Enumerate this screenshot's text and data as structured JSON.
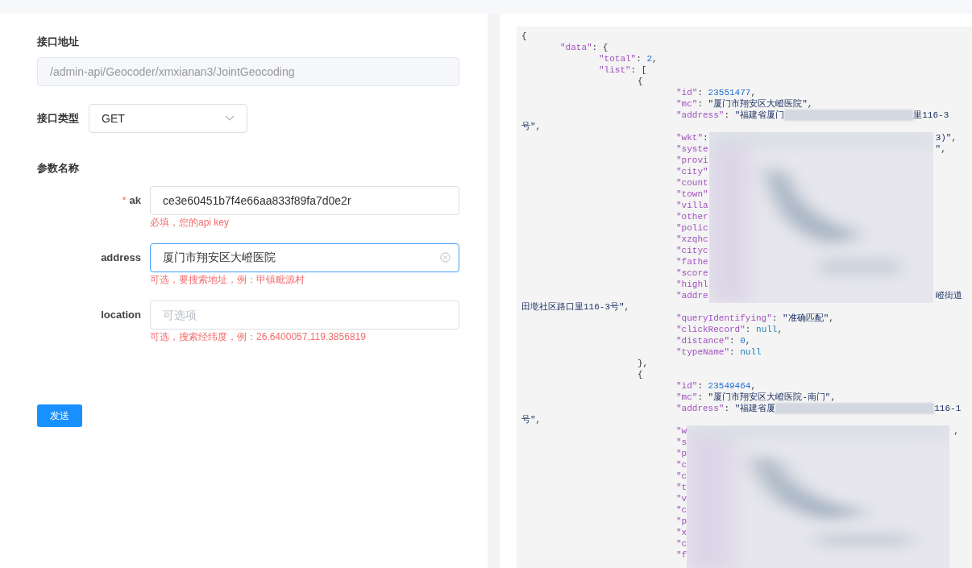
{
  "form": {
    "url": {
      "label": "接口地址",
      "value": "/admin-api/Geocoder/xmxianan3/JointGeocoding",
      "disabled": true
    },
    "method": {
      "label": "接口类型",
      "value": "GET"
    },
    "params_label": "参数名称",
    "required_mark": "*",
    "params": [
      {
        "label": "ak",
        "required": true,
        "value": "ce3e60451b7f4e66aa833f89fa7d0e2r",
        "focused": false,
        "hint": "必填，您的api key"
      },
      {
        "label": "address",
        "required": false,
        "value": "厦门市翔安区大嶝医院",
        "focused": true,
        "hint": "可选，要搜索地址，例：甲镇毗源村"
      },
      {
        "label": "location",
        "required": false,
        "placeholder": "可选项",
        "focused": false,
        "hint": "可选，搜索经纬度，例：26.6400057,119.3856819"
      }
    ],
    "submit": "发送"
  },
  "response": {
    "lines": [
      {
        "parts": [
          {
            "kind": "punct",
            "text": "{"
          }
        ],
        "children": [
          {
            "parts": [
              {
                "kind": "key",
                "text": "\"data\""
              },
              {
                "kind": "punct",
                "text": ": {"
              }
            ],
            "children": [
              {
                "parts": [
                  {
                    "kind": "key",
                    "text": "\"total\""
                  },
                  {
                    "kind": "punct",
                    "text": ": "
                  },
                  {
                    "kind": "num",
                    "text": "2"
                  },
                  {
                    "kind": "punct",
                    "text": ","
                  }
                ]
              },
              {
                "parts": [
                  {
                    "kind": "key",
                    "text": "\"list\""
                  },
                  {
                    "kind": "punct",
                    "text": ": ["
                  }
                ],
                "children": [
                  {
                    "parts": [
                      {
                        "kind": "punct",
                        "text": "{"
                      }
                    ],
                    "children": [
                      {
                        "parts": [
                          {
                            "kind": "key",
                            "text": "\"id\""
                          },
                          {
                            "kind": "punct",
                            "text": ": "
                          },
                          {
                            "kind": "num",
                            "text": "23551477"
                          },
                          {
                            "kind": "punct",
                            "text": ","
                          }
                        ]
                      },
                      {
                        "parts": [
                          {
                            "kind": "key",
                            "text": "\"mc\""
                          },
                          {
                            "kind": "punct",
                            "text": ": "
                          },
                          {
                            "kind": "str",
                            "text": "\"厦门市翔安区大嶝医院\""
                          },
                          {
                            "kind": "punct",
                            "text": ","
                          }
                        ]
                      },
                      {
                        "parts": [
                          {
                            "kind": "key",
                            "text": "\"address\""
                          },
                          {
                            "kind": "punct",
                            "text": ": "
                          },
                          {
                            "kind": "str",
                            "text": "\"福建省厦门"
                          },
                          {
                            "kind": "redacted"
                          },
                          {
                            "kind": "str",
                            "text": "里116-3"
                          }
                        ],
                        "wrap": [
                          {
                            "kind": "str",
                            "text": "号\""
                          },
                          {
                            "kind": "punct",
                            "text": ","
                          }
                        ]
                      },
                      {
                        "parts": [
                          {
                            "kind": "key",
                            "text": "\"wkt\""
                          },
                          {
                            "kind": "punct",
                            "text": ":"
                          },
                          {
                            "kind": "redacted"
                          },
                          {
                            "kind": "str",
                            "text": "3)\""
                          },
                          {
                            "kind": "punct",
                            "text": ","
                          }
                        ]
                      },
                      {
                        "parts": [
                          {
                            "kind": "key",
                            "text": "\"syste"
                          },
                          {
                            "kind": "redacted"
                          },
                          {
                            "kind": "str",
                            "text": "\""
                          },
                          {
                            "kind": "punct",
                            "text": ","
                          }
                        ]
                      },
                      {
                        "parts": [
                          {
                            "kind": "key",
                            "text": "\"provi"
                          }
                        ]
                      },
                      {
                        "parts": [
                          {
                            "kind": "key",
                            "text": "\"city\""
                          }
                        ]
                      },
                      {
                        "parts": [
                          {
                            "kind": "key",
                            "text": "\"count"
                          }
                        ]
                      },
                      {
                        "parts": [
                          {
                            "kind": "key",
                            "text": "\"town\""
                          }
                        ]
                      },
                      {
                        "parts": [
                          {
                            "kind": "key",
                            "text": "\"villa"
                          }
                        ]
                      },
                      {
                        "parts": [
                          {
                            "kind": "key",
                            "text": "\"other"
                          }
                        ]
                      },
                      {
                        "parts": [
                          {
                            "kind": "key",
                            "text": "\"polic"
                          }
                        ]
                      },
                      {
                        "parts": [
                          {
                            "kind": "key",
                            "text": "\"xzqhc"
                          }
                        ]
                      },
                      {
                        "parts": [
                          {
                            "kind": "key",
                            "text": "\"cityc"
                          }
                        ]
                      },
                      {
                        "parts": [
                          {
                            "kind": "key",
                            "text": "\"fathe"
                          }
                        ]
                      },
                      {
                        "parts": [
                          {
                            "kind": "key",
                            "text": "\"score"
                          }
                        ]
                      },
                      {
                        "parts": [
                          {
                            "kind": "key",
                            "text": "\"highl"
                          }
                        ]
                      },
                      {
                        "parts": [
                          {
                            "kind": "key",
                            "text": "\"addre"
                          },
                          {
                            "kind": "redacted"
                          },
                          {
                            "kind": "str",
                            "text": "嶝街道"
                          }
                        ],
                        "wrap": [
                          {
                            "kind": "str",
                            "text": "田墘社区路口里116-3号\""
                          },
                          {
                            "kind": "punct",
                            "text": ","
                          }
                        ]
                      },
                      {
                        "parts": [
                          {
                            "kind": "key",
                            "text": "\"queryIdentifying\""
                          },
                          {
                            "kind": "punct",
                            "text": ": "
                          },
                          {
                            "kind": "str",
                            "text": "\"准确匹配\""
                          },
                          {
                            "kind": "punct",
                            "text": ","
                          }
                        ]
                      },
                      {
                        "parts": [
                          {
                            "kind": "key",
                            "text": "\"clickRecord\""
                          },
                          {
                            "kind": "punct",
                            "text": ": "
                          },
                          {
                            "kind": "null",
                            "text": "null"
                          },
                          {
                            "kind": "punct",
                            "text": ","
                          }
                        ]
                      },
                      {
                        "parts": [
                          {
                            "kind": "key",
                            "text": "\"distance\""
                          },
                          {
                            "kind": "punct",
                            "text": ": "
                          },
                          {
                            "kind": "num",
                            "text": "0"
                          },
                          {
                            "kind": "punct",
                            "text": ","
                          }
                        ]
                      },
                      {
                        "parts": [
                          {
                            "kind": "key",
                            "text": "\"typeName\""
                          },
                          {
                            "kind": "punct",
                            "text": ": "
                          },
                          {
                            "kind": "null",
                            "text": "null"
                          }
                        ]
                      }
                    ]
                  },
                  {
                    "parts": [
                      {
                        "kind": "punct",
                        "text": "},"
                      }
                    ]
                  },
                  {
                    "parts": [
                      {
                        "kind": "punct",
                        "text": "{"
                      }
                    ],
                    "children": [
                      {
                        "parts": [
                          {
                            "kind": "key",
                            "text": "\"id\""
                          },
                          {
                            "kind": "punct",
                            "text": ": "
                          },
                          {
                            "kind": "num",
                            "text": "23549464"
                          },
                          {
                            "kind": "punct",
                            "text": ","
                          }
                        ]
                      },
                      {
                        "parts": [
                          {
                            "kind": "key",
                            "text": "\"mc\""
                          },
                          {
                            "kind": "punct",
                            "text": ": "
                          },
                          {
                            "kind": "str",
                            "text": "\"厦门市翔安区大嶝医院-南门\""
                          },
                          {
                            "kind": "punct",
                            "text": ","
                          }
                        ]
                      },
                      {
                        "parts": [
                          {
                            "kind": "key",
                            "text": "\"address\""
                          },
                          {
                            "kind": "punct",
                            "text": ": "
                          },
                          {
                            "kind": "str",
                            "text": "\"福建省厦"
                          },
                          {
                            "kind": "redacted"
                          },
                          {
                            "kind": "str",
                            "text": "116-1"
                          }
                        ],
                        "wrap": [
                          {
                            "kind": "str",
                            "text": "号\""
                          },
                          {
                            "kind": "punct",
                            "text": ","
                          }
                        ]
                      },
                      {
                        "parts": [
                          {
                            "kind": "key",
                            "text": "\"w"
                          },
                          {
                            "kind": "redacted"
                          },
                          {
                            "kind": "punct",
                            "text": ","
                          }
                        ]
                      },
                      {
                        "parts": [
                          {
                            "kind": "key",
                            "text": "\"s"
                          }
                        ]
                      },
                      {
                        "parts": [
                          {
                            "kind": "key",
                            "text": "\"p"
                          }
                        ]
                      },
                      {
                        "parts": [
                          {
                            "kind": "key",
                            "text": "\"c"
                          }
                        ]
                      },
                      {
                        "parts": [
                          {
                            "kind": "key",
                            "text": "\"c"
                          }
                        ]
                      },
                      {
                        "parts": [
                          {
                            "kind": "key",
                            "text": "\"t"
                          }
                        ]
                      },
                      {
                        "parts": [
                          {
                            "kind": "key",
                            "text": "\"v"
                          }
                        ]
                      },
                      {
                        "parts": [
                          {
                            "kind": "key",
                            "text": "\"c"
                          }
                        ]
                      },
                      {
                        "parts": [
                          {
                            "kind": "key",
                            "text": "\"p"
                          }
                        ]
                      },
                      {
                        "parts": [
                          {
                            "kind": "key",
                            "text": "\"x"
                          }
                        ]
                      },
                      {
                        "parts": [
                          {
                            "kind": "key",
                            "text": "\"c"
                          }
                        ]
                      },
                      {
                        "parts": [
                          {
                            "kind": "key",
                            "text": "\"f"
                          }
                        ]
                      }
                    ]
                  }
                ]
              }
            ]
          }
        ]
      }
    ]
  }
}
